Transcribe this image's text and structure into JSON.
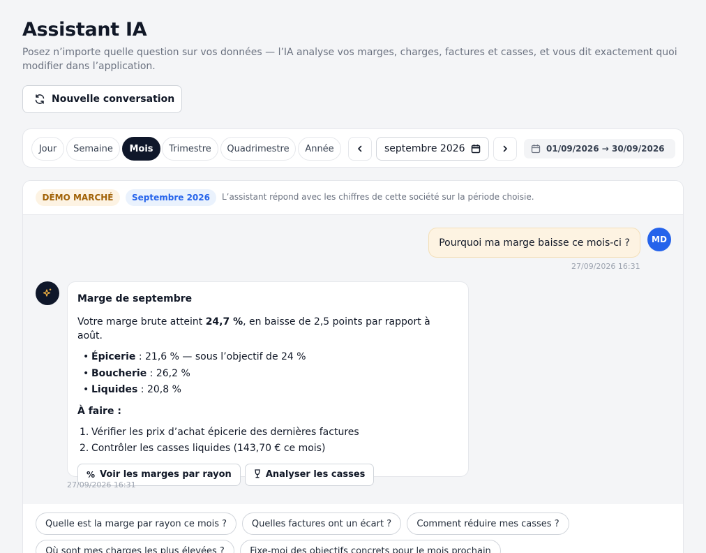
{
  "header": {
    "title": "Assistant IA",
    "subtitle": "Posez n’importe quelle question sur vos données — l’IA analyse vos marges, charges, factures et casses, et vous dit exactement quoi modifier dans l’application.",
    "new_conversation_label": "Nouvelle conversation"
  },
  "period": {
    "tabs": [
      "Jour",
      "Semaine",
      "Mois",
      "Trimestre",
      "Quadrimestre",
      "Année"
    ],
    "active_tab": "Mois",
    "date_value": "septembre 2026",
    "range_label": "01/09/2026 → 30/09/2026"
  },
  "chat": {
    "tag_company": "DÉMO MARCHÉ",
    "tag_month": "Septembre 2026",
    "head_note": "L’assistant répond avec les chiffres de cette société sur la période choisie.",
    "user_message": "Pourquoi ma marge baisse ce mois-ci ?",
    "user_initials": "MD",
    "user_timestamp": "27/09/2026 16:31",
    "bot": {
      "title": "Marge de septembre",
      "intro_before": "Votre marge brute atteint ",
      "intro_value": "24,7 %",
      "intro_after": ", en baisse de 2,5 points par rapport à août.",
      "bullets": [
        {
          "label": "Épicerie",
          "text": " : 21,6 % — sous l’objectif de 24 %"
        },
        {
          "label": "Boucherie",
          "text": " : 26,2 %"
        },
        {
          "label": "Liquides",
          "text": " : 20,8 %"
        }
      ],
      "todo_title": "À faire :",
      "todo": [
        {
          "num": "1.",
          "text": "Vérifier les prix d’achat épicerie des dernières factures"
        },
        {
          "num": "2.",
          "text": "Contrôler les casses liquides (143,70 € ce mois)"
        }
      ],
      "actions": [
        {
          "icon": "%",
          "label": "Voir les marges par rayon"
        },
        {
          "icon": "🍷",
          "label": "Analyser les casses"
        }
      ],
      "timestamp": "27/09/2026 16:31"
    },
    "suggestions": [
      "Quelle est la marge par rayon ce mois ?",
      "Quelles factures ont un écart ?",
      "Comment réduire mes casses ?",
      "Où sont mes charges les plus élevées ?",
      "Fixe-moi des objectifs concrets pour le mois prochain"
    ]
  },
  "colors": {
    "accent": "#0f172a",
    "user_avatar": "#2563eb",
    "user_bubble": "#fdf3e2",
    "tag_demo_text": "#a16207",
    "tag_month_text": "#2563eb"
  }
}
